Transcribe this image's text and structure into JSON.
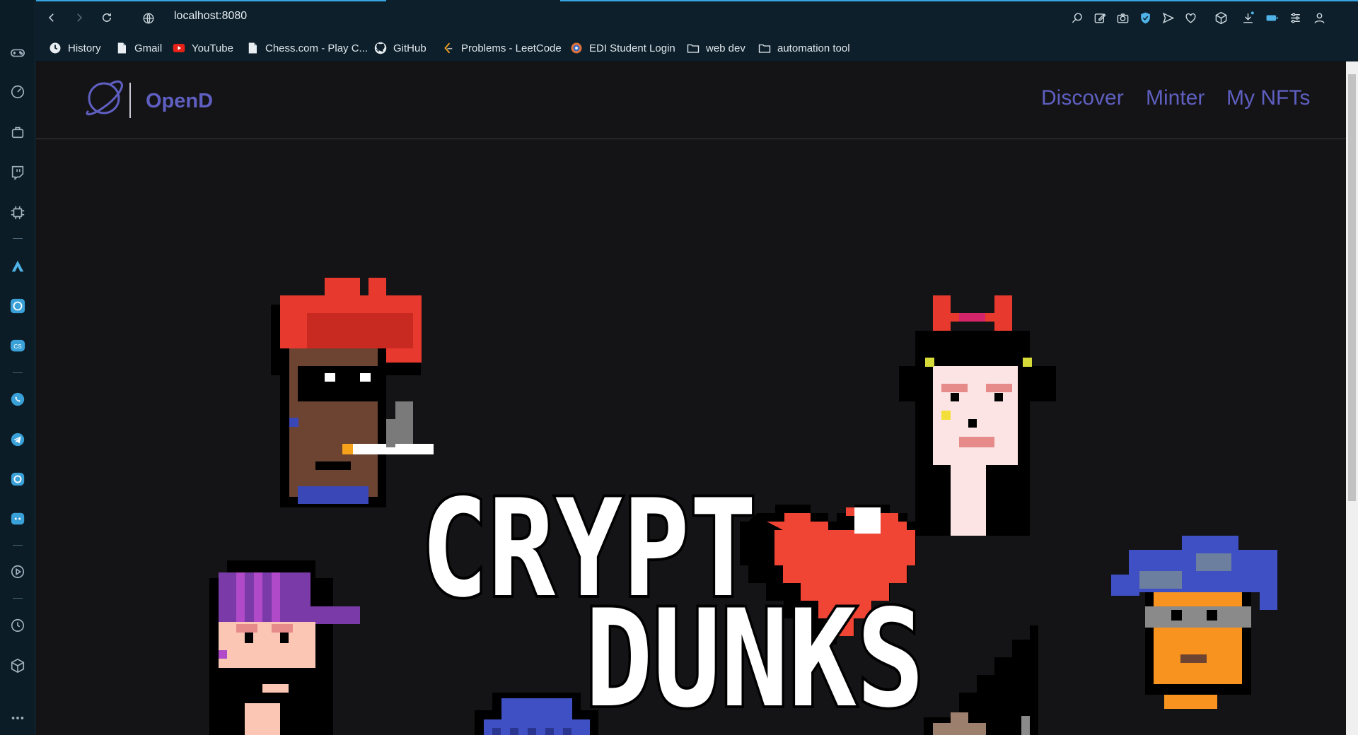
{
  "browser": {
    "url": "localhost:8080",
    "bookmarks": [
      {
        "label": "History",
        "icon": "history-clock-icon"
      },
      {
        "label": "Gmail",
        "icon": "page-icon"
      },
      {
        "label": "YouTube",
        "icon": "youtube-icon"
      },
      {
        "label": "Chess.com - Play C...",
        "icon": "page-icon"
      },
      {
        "label": "GitHub",
        "icon": "github-icon"
      },
      {
        "label": "Problems - LeetCode",
        "icon": "leetcode-icon"
      },
      {
        "label": "EDI Student Login",
        "icon": "edi-icon"
      },
      {
        "label": "web dev",
        "icon": "folder-icon"
      },
      {
        "label": "automation tool",
        "icon": "folder-icon"
      }
    ],
    "accent": "#35a4e0"
  },
  "site": {
    "brand": "OpenD",
    "nav": [
      "Discover",
      "Minter",
      "My NFTs"
    ],
    "brand_color": "#5f5fc2",
    "background": "#141416"
  },
  "hero": {
    "title_line1": "CRYPT",
    "title_line2": "DUNKS",
    "heart_color": "#f04434"
  }
}
